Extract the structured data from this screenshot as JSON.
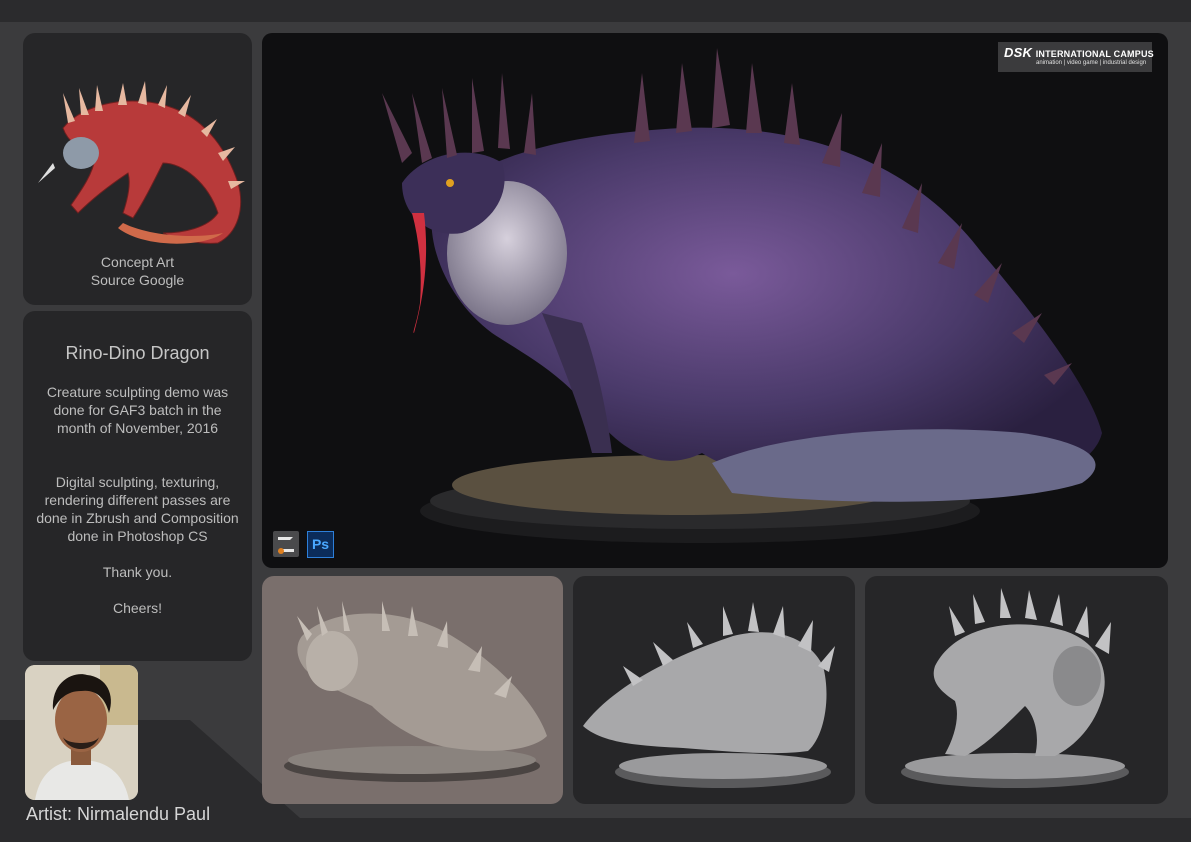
{
  "concept": {
    "caption_line1": "Concept Art",
    "caption_line2": "Source Google"
  },
  "info": {
    "title": "Rino-Dino Dragon",
    "paragraph1": [
      "Creature sculpting demo was",
      "done for GAF3 batch in the",
      "month of November, 2016"
    ],
    "paragraph2": [
      "Digital sculpting, texturing,",
      "rendering different passes are",
      "done in Zbrush and Composition",
      "done in Photoshop CS"
    ],
    "thanks": "Thank you.",
    "cheers": "Cheers!"
  },
  "artist": {
    "label": "Artist: Nirmalendu Paul"
  },
  "logo": {
    "brand": "DSK",
    "campus": "INTERNATIONAL CAMPUS",
    "tagline": "animation | video game | industrial design"
  },
  "icons": {
    "ps_label": "Ps",
    "zbrush": "zbrush-icon",
    "photoshop": "photoshop-icon"
  },
  "colors": {
    "background": "#3b3b3d",
    "panel": "#262628",
    "hero_bg": "#0f0f11",
    "accent_purple": "#5a4a8a",
    "accent_red": "#c03030"
  }
}
